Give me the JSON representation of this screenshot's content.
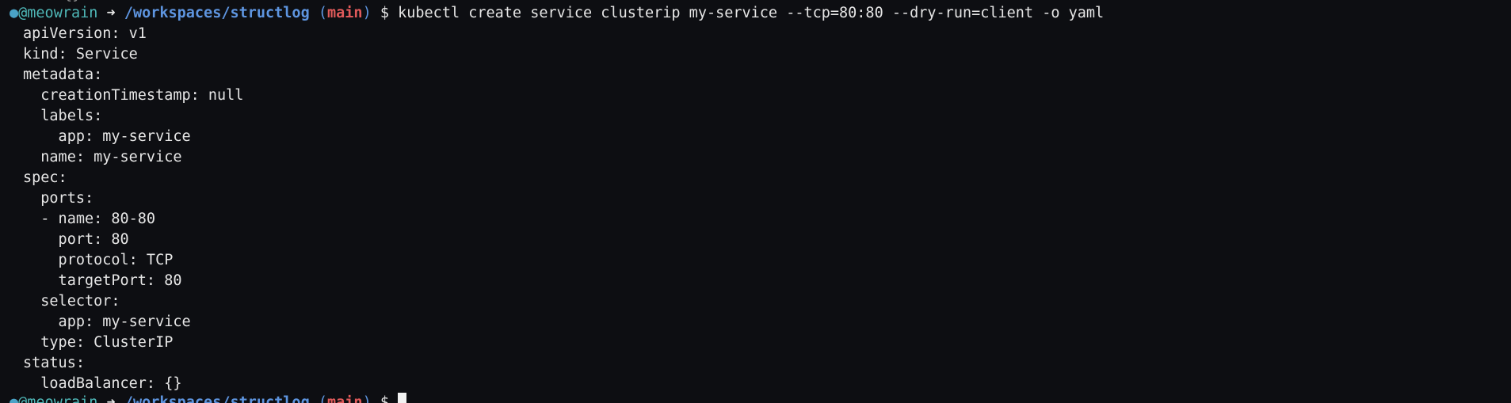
{
  "colors": {
    "background": "#0d0e12",
    "text": "#e6e6e6",
    "user": "#4fb8b8",
    "path": "#5e95e0",
    "branch": "#e05a5a"
  },
  "top_fragment": "{}",
  "prompt": {
    "dot_icon": "bullet-icon",
    "user": "@meowrain",
    "arrow": "➜",
    "path": "/workspaces/structlog",
    "paren_open": "(",
    "branch": "main",
    "paren_close": ")",
    "symbol": "$",
    "command": "kubectl create service clusterip my-service --tcp=80:80 --dry-run=client -o yaml"
  },
  "output_lines": [
    "apiVersion: v1",
    "kind: Service",
    "metadata:",
    "  creationTimestamp: null",
    "  labels:",
    "    app: my-service",
    "  name: my-service",
    "spec:",
    "  ports:",
    "  - name: 80-80",
    "    port: 80",
    "    protocol: TCP",
    "    targetPort: 80",
    "  selector:",
    "    app: my-service",
    "  type: ClusterIP",
    "status:",
    "  loadBalancer: {}"
  ],
  "next_prompt": {
    "user": "@meowrain",
    "arrow": "➜",
    "path": "/workspaces/structlog",
    "paren_open": "(",
    "branch": "main",
    "paren_close": ")",
    "symbol": "$"
  }
}
